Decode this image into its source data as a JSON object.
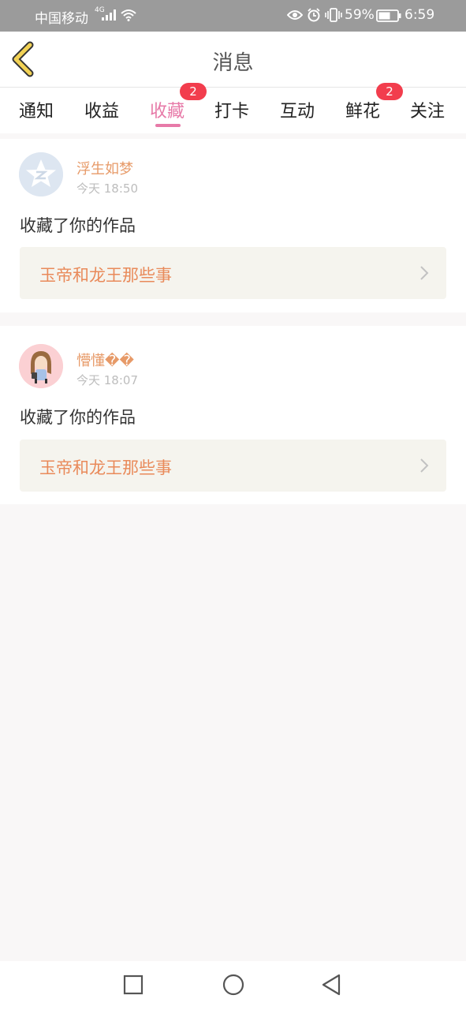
{
  "status_bar": {
    "carrier": "中国移动",
    "network": "4G",
    "battery": "59%",
    "time": "6:59",
    "icons": [
      "signal-icon",
      "wifi-icon",
      "eye-icon",
      "alarm-icon",
      "vibrate-icon",
      "battery-icon"
    ]
  },
  "header": {
    "title": "消息",
    "back_icon": "chevron-left-icon"
  },
  "tabs": [
    {
      "label": "通知",
      "badge": ""
    },
    {
      "label": "收益",
      "badge": ""
    },
    {
      "label": "收藏",
      "badge": "2",
      "active": true
    },
    {
      "label": "打卡",
      "badge": ""
    },
    {
      "label": "互动",
      "badge": ""
    },
    {
      "label": "鲜花",
      "badge": "2"
    },
    {
      "label": "关注",
      "badge": ""
    }
  ],
  "messages": [
    {
      "user": "浮生如梦",
      "time": "今天 18:50",
      "action": "收藏了你的作品",
      "work_title": "玉帝和龙王那些事"
    },
    {
      "user": "懵懂��",
      "time": "今天 18:07",
      "action": "收藏了你的作品",
      "work_title": "玉帝和龙王那些事"
    }
  ],
  "colors": {
    "accent": "#e77aa8",
    "badge": "#f23d4d",
    "username": "#e79a68",
    "work_title": "#e98a5a",
    "back_icon": "#f2d255"
  },
  "nav": [
    "recent-apps-icon",
    "home-icon",
    "back-icon"
  ]
}
